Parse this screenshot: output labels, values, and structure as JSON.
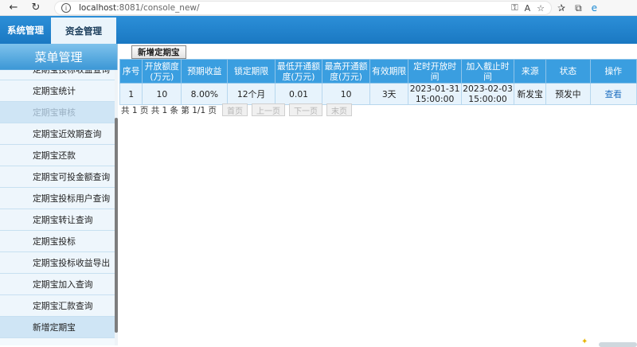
{
  "browser": {
    "url_host": "localhost",
    "url_rest": ":8081/console_new/",
    "back_icon": "back-arrow-icon",
    "refresh_icon": "refresh-icon"
  },
  "topnav": {
    "tabs": [
      {
        "label": "系统管理",
        "active": false
      },
      {
        "label": "资金管理",
        "active": true
      }
    ]
  },
  "sidebar": {
    "title": "菜单管理",
    "items": [
      {
        "label": "定期宝投标收益查询",
        "state": "normal"
      },
      {
        "label": "定期宝统计",
        "state": "normal"
      },
      {
        "label": "定期宝审核",
        "state": "muted"
      },
      {
        "label": "定期宝近效期查询",
        "state": "normal"
      },
      {
        "label": "定期宝还款",
        "state": "normal"
      },
      {
        "label": "定期宝可投金额查询",
        "state": "normal"
      },
      {
        "label": "定期宝投标用户查询",
        "state": "normal"
      },
      {
        "label": "定期宝转让查询",
        "state": "normal"
      },
      {
        "label": "定期宝投标",
        "state": "normal"
      },
      {
        "label": "定期宝投标收益导出",
        "state": "normal"
      },
      {
        "label": "定期宝加入查询",
        "state": "normal"
      },
      {
        "label": "定期宝汇款查询",
        "state": "normal"
      },
      {
        "label": "新增定期宝",
        "state": "active"
      }
    ]
  },
  "main": {
    "add_button": "新增定期宝",
    "table": {
      "headers": [
        "序号",
        "开放额度(万元)",
        "预期收益",
        "锁定期限",
        "最低开通额度(万元)",
        "最高开通额度(万元)",
        "有效期限",
        "定时开放时间",
        "加入截止时间",
        "来源",
        "状态",
        "操作"
      ],
      "rows": [
        [
          "1",
          "10",
          "8.00%",
          "12个月",
          "0.01",
          "10",
          "3天",
          "2023-01-31 15:00:00",
          "2023-02-03 15:00:00",
          "新发宝",
          "预发中",
          "查看"
        ]
      ]
    },
    "pager": {
      "summary": "共 1 页  共 1 条  第  1/1 页",
      "first": "首页",
      "prev": "上一页",
      "next": "下一页",
      "last": "末页"
    }
  }
}
